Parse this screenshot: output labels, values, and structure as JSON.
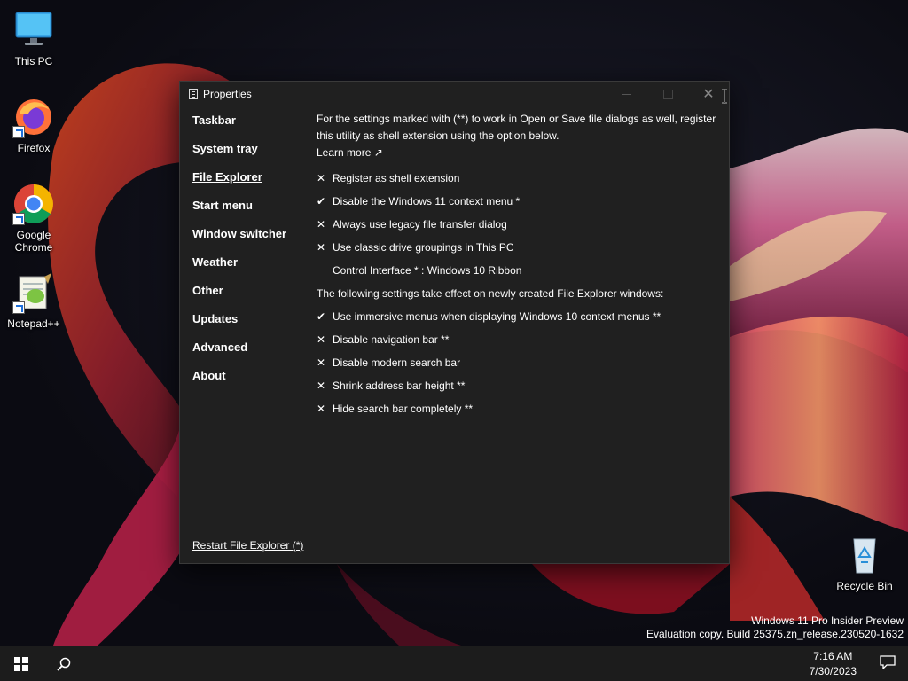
{
  "desktop": {
    "icons": [
      {
        "label": "This PC"
      },
      {
        "label": "Firefox"
      },
      {
        "label": "Google Chrome"
      },
      {
        "label": "Notepad++"
      },
      {
        "label": "Recycle Bin"
      }
    ]
  },
  "window": {
    "title": "Properties",
    "close_glyph": "✕",
    "sidebar": [
      {
        "label": "Taskbar"
      },
      {
        "label": "System tray"
      },
      {
        "label": "File Explorer"
      },
      {
        "label": "Start menu"
      },
      {
        "label": "Window switcher"
      },
      {
        "label": "Weather"
      },
      {
        "label": "Other"
      },
      {
        "label": "Updates"
      },
      {
        "label": "Advanced"
      },
      {
        "label": "About"
      }
    ],
    "content": {
      "intro": "For the settings marked with (**) to work in Open or Save file dialogs as well, register this utility as shell extension using the option below.",
      "learn_more": "Learn more ↗",
      "options_a": [
        {
          "label": "Register as shell extension",
          "checked": false
        },
        {
          "label": "Disable the Windows 11 context menu *",
          "checked": true
        },
        {
          "label": "Always use legacy file transfer dialog",
          "checked": false
        },
        {
          "label": "Use classic drive groupings in This PC",
          "checked": false
        }
      ],
      "control_interface": "Control Interface * : Windows 10 Ribbon",
      "heading2": "The following settings take effect on newly created File Explorer windows:",
      "options_b": [
        {
          "label": "Use immersive menus when displaying Windows 10 context menus **",
          "checked": true
        },
        {
          "label": "Disable navigation bar **",
          "checked": false
        },
        {
          "label": "Disable modern search bar",
          "checked": false
        },
        {
          "label": "Shrink address bar height **",
          "checked": false
        },
        {
          "label": "Hide search bar completely **",
          "checked": false
        }
      ]
    },
    "restart_link": "Restart File Explorer (*)"
  },
  "watermark": {
    "line1": "Windows 11 Pro Insider Preview",
    "line2": "Evaluation copy. Build 25375.zn_release.230520-1632"
  },
  "taskbar": {
    "time": "7:16 AM",
    "date": "7/30/2023"
  }
}
